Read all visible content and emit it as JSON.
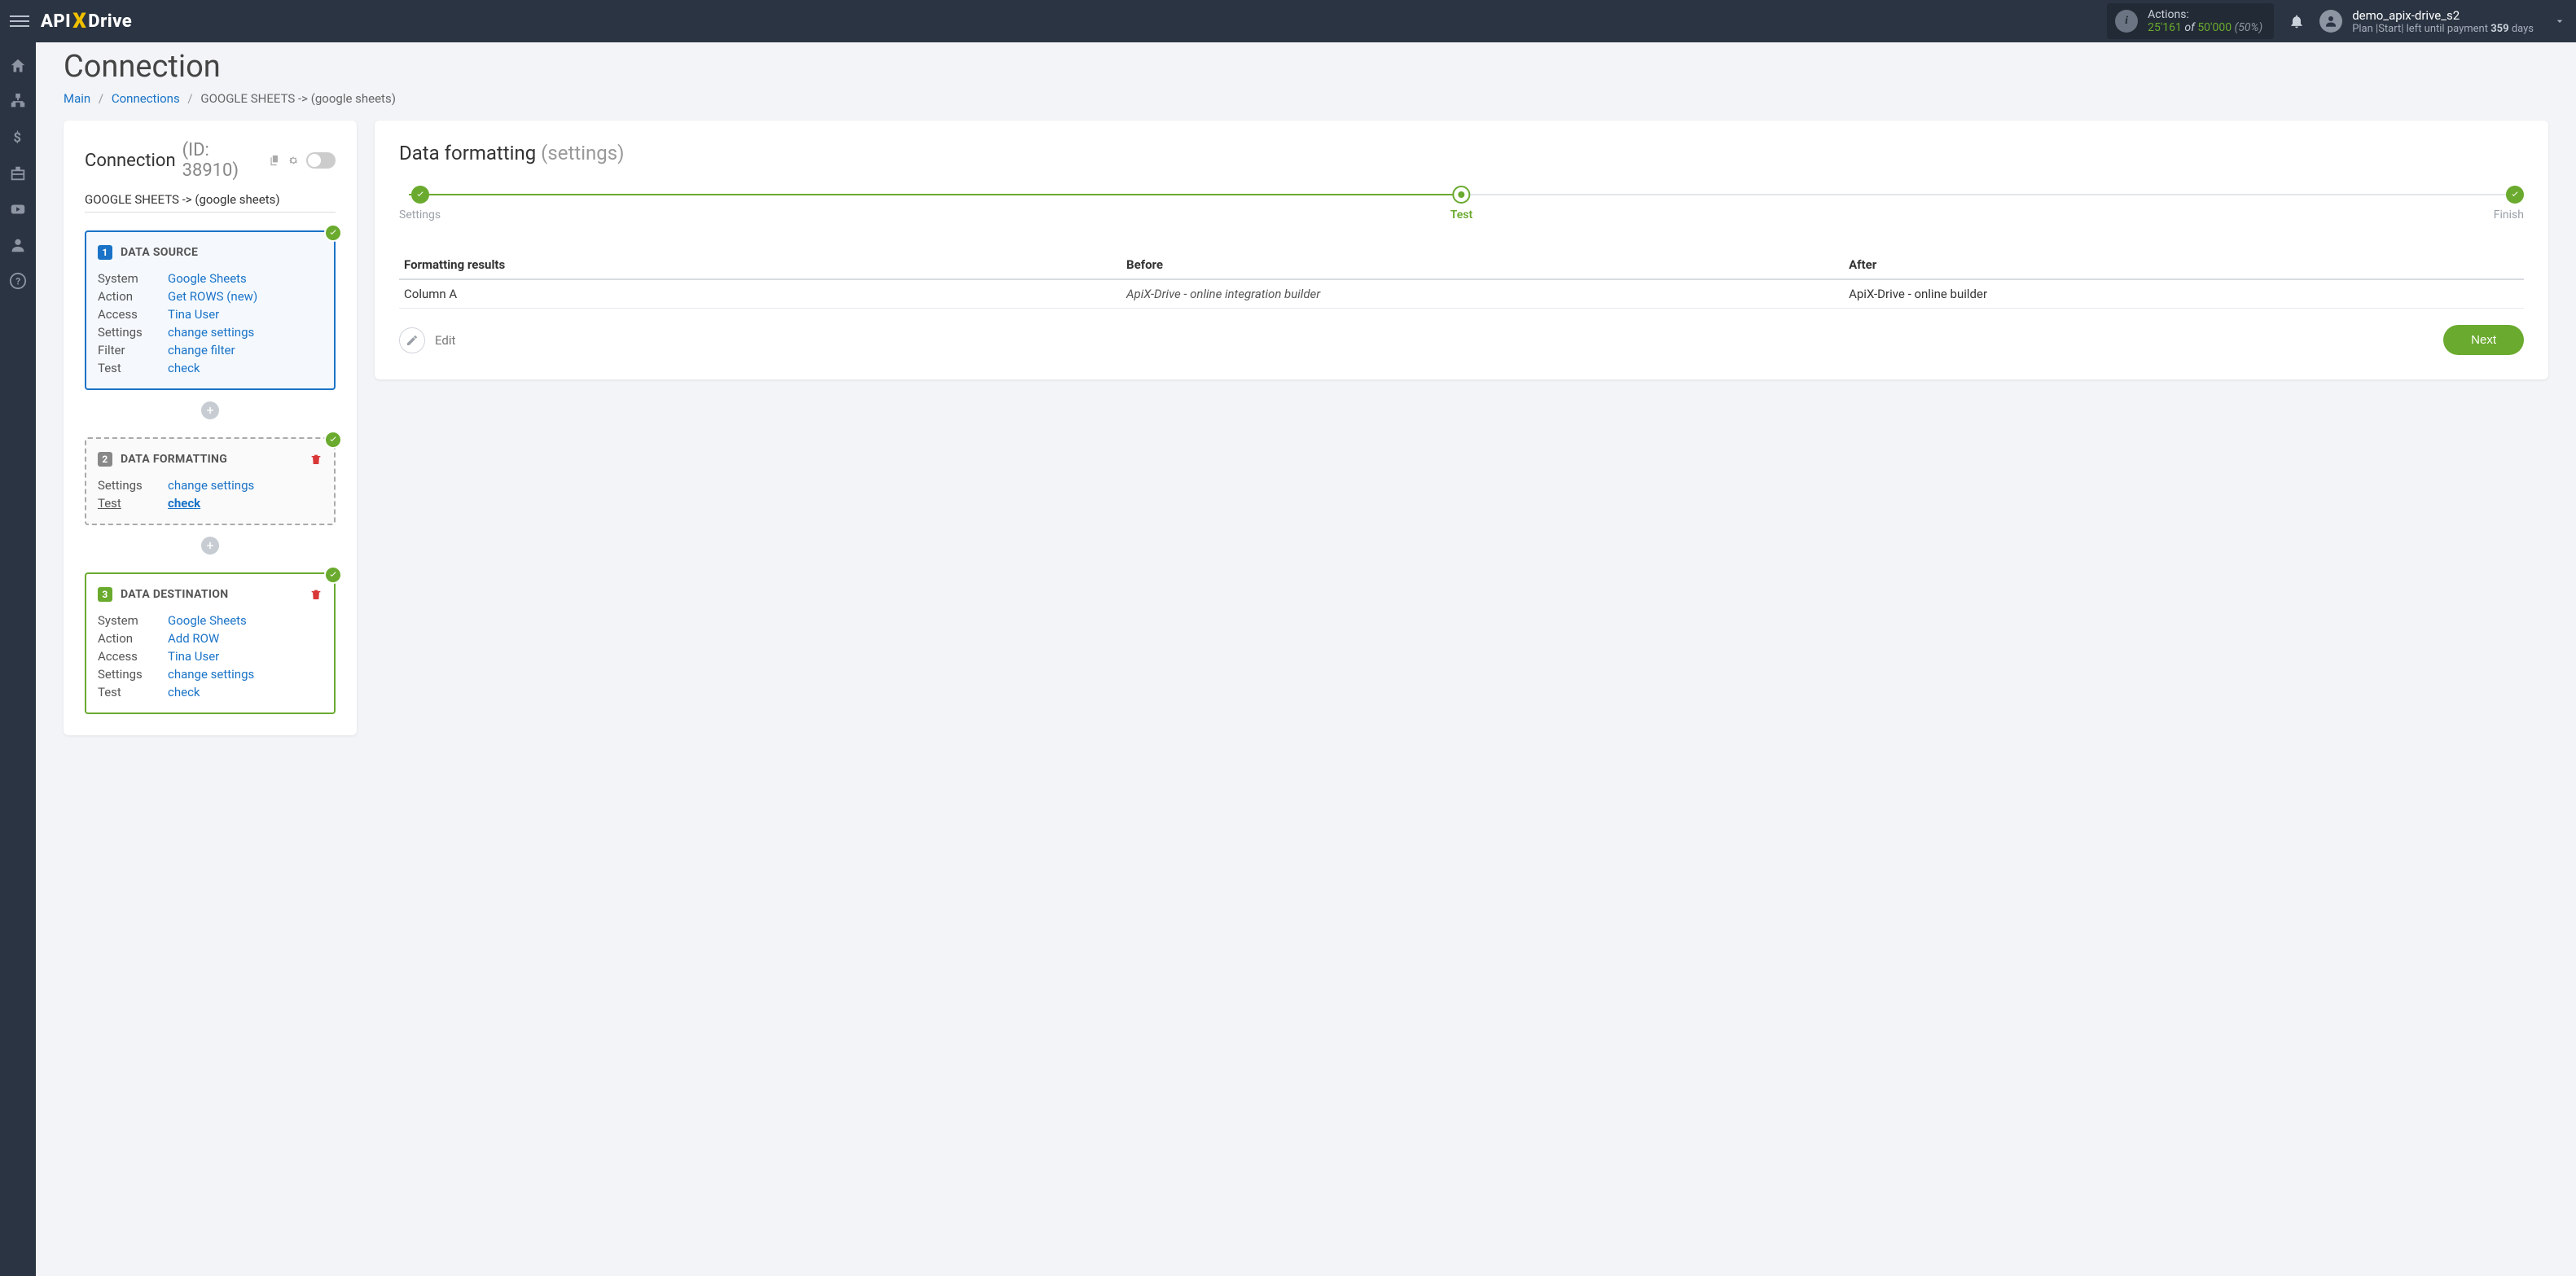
{
  "topbar": {
    "logo_api": "API",
    "logo_x": "X",
    "logo_drive": "Drive",
    "actions_label": "Actions:",
    "actions_used": "25'161",
    "actions_of": "of",
    "actions_total": "50'000",
    "actions_pct": "(50%)",
    "user_name": "demo_apix-drive_s2",
    "user_plan_prefix": "Plan |Start| left until payment",
    "user_plan_days": "359",
    "user_plan_suffix": "days"
  },
  "page": {
    "title": "Connection",
    "crumb_main": "Main",
    "crumb_conn": "Connections",
    "crumb_current": "GOOGLE SHEETS -> (google sheets)"
  },
  "left": {
    "title": "Connection",
    "id_label": "(ID: 38910)",
    "sub": "GOOGLE SHEETS -> (google sheets)",
    "source": {
      "num": "1",
      "title": "DATA SOURCE",
      "rows": [
        {
          "lbl": "System",
          "val": "Google Sheets"
        },
        {
          "lbl": "Action",
          "val": "Get ROWS (new)"
        },
        {
          "lbl": "Access",
          "val": "Tina User"
        },
        {
          "lbl": "Settings",
          "val": "change settings"
        },
        {
          "lbl": "Filter",
          "val": "change filter"
        },
        {
          "lbl": "Test",
          "val": "check"
        }
      ]
    },
    "format": {
      "num": "2",
      "title": "DATA FORMATTING",
      "rows": [
        {
          "lbl": "Settings",
          "val": "change settings"
        },
        {
          "lbl": "Test",
          "val": "check"
        }
      ]
    },
    "dest": {
      "num": "3",
      "title": "DATA DESTINATION",
      "rows": [
        {
          "lbl": "System",
          "val": "Google Sheets"
        },
        {
          "lbl": "Action",
          "val": "Add ROW"
        },
        {
          "lbl": "Access",
          "val": "Tina User"
        },
        {
          "lbl": "Settings",
          "val": "change settings"
        },
        {
          "lbl": "Test",
          "val": "check"
        }
      ]
    }
  },
  "right": {
    "title": "Data formatting",
    "subtitle": "(settings)",
    "steps": {
      "settings": "Settings",
      "test": "Test",
      "finish": "Finish"
    },
    "table": {
      "h1": "Formatting results",
      "h2": "Before",
      "h3": "After",
      "row": {
        "c1": "Column A",
        "c2": "ApiX-Drive - online integration builder",
        "c3": "ApiX-Drive - online builder"
      }
    },
    "edit": "Edit",
    "next": "Next"
  }
}
